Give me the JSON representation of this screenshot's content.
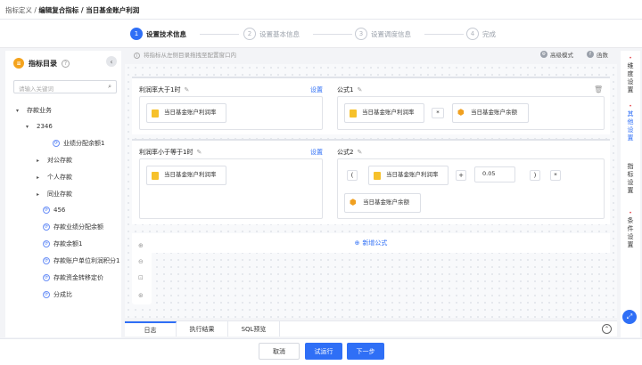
{
  "breadcrumb": {
    "parent": "指标定义",
    "sep": "/",
    "current": "编辑复合指标 / 当日基金账户利润"
  },
  "steps": [
    {
      "num": "1",
      "label": "设置技术信息"
    },
    {
      "num": "2",
      "label": "设置基本信息"
    },
    {
      "num": "3",
      "label": "设置调度信息"
    },
    {
      "num": "4",
      "label": "完成"
    }
  ],
  "sidebar": {
    "title": "指标目录",
    "help": "?",
    "collapse": "‹",
    "search_placeholder": "请输入关键词",
    "tree": [
      {
        "label": "存款业务",
        "caret": "▾"
      },
      {
        "label": "2346",
        "caret": "▾"
      },
      {
        "label": "业绩分配余额1"
      },
      {
        "label": "对公存款",
        "caret": "▸"
      },
      {
        "label": "个人存款",
        "caret": "▸"
      },
      {
        "label": "同业存款",
        "caret": "▸"
      },
      {
        "label": "456"
      },
      {
        "label": "存款业绩分配余额"
      },
      {
        "label": "存款余额1"
      },
      {
        "label": "存款账户单位利润积分1"
      },
      {
        "label": "存款资金转移定价"
      },
      {
        "label": "分成比"
      }
    ]
  },
  "toolbar": {
    "tip": "将指标从左侧目录拖拽至配置窗口内",
    "advanced": "高级模式",
    "func": "函数"
  },
  "rules": [
    {
      "condition": "利润率大于1时",
      "set": "设置",
      "formula_label": "公式1",
      "cond_field": "当日基金账户利润率",
      "formula": {
        "field1": "当日基金账户利润率",
        "op": "*",
        "field2": "当日基金账户余额"
      }
    },
    {
      "condition": "利润率小于等于1时",
      "set": "设置",
      "formula_label": "公式2",
      "cond_field": "当日基金账户利润率",
      "formula": {
        "lparen": "(",
        "field1": "当日基金账户利润率",
        "plus": "+",
        "num": "0.05",
        "rparen": ")",
        "op": "*",
        "field2": "当日基金账户余额"
      }
    }
  ],
  "add_formula": "新增公式",
  "right_panel": [
    "维度设置",
    "其他设置",
    "指标设置",
    "条件设置"
  ],
  "bottom_tabs": [
    "日志",
    "执行结果",
    "SQL预览"
  ],
  "footer": {
    "cancel": "取消",
    "trial": "试运行",
    "next": "下一步"
  },
  "colors": {
    "primary": "#2f6ff6",
    "field_icon": "#f6c12b"
  }
}
